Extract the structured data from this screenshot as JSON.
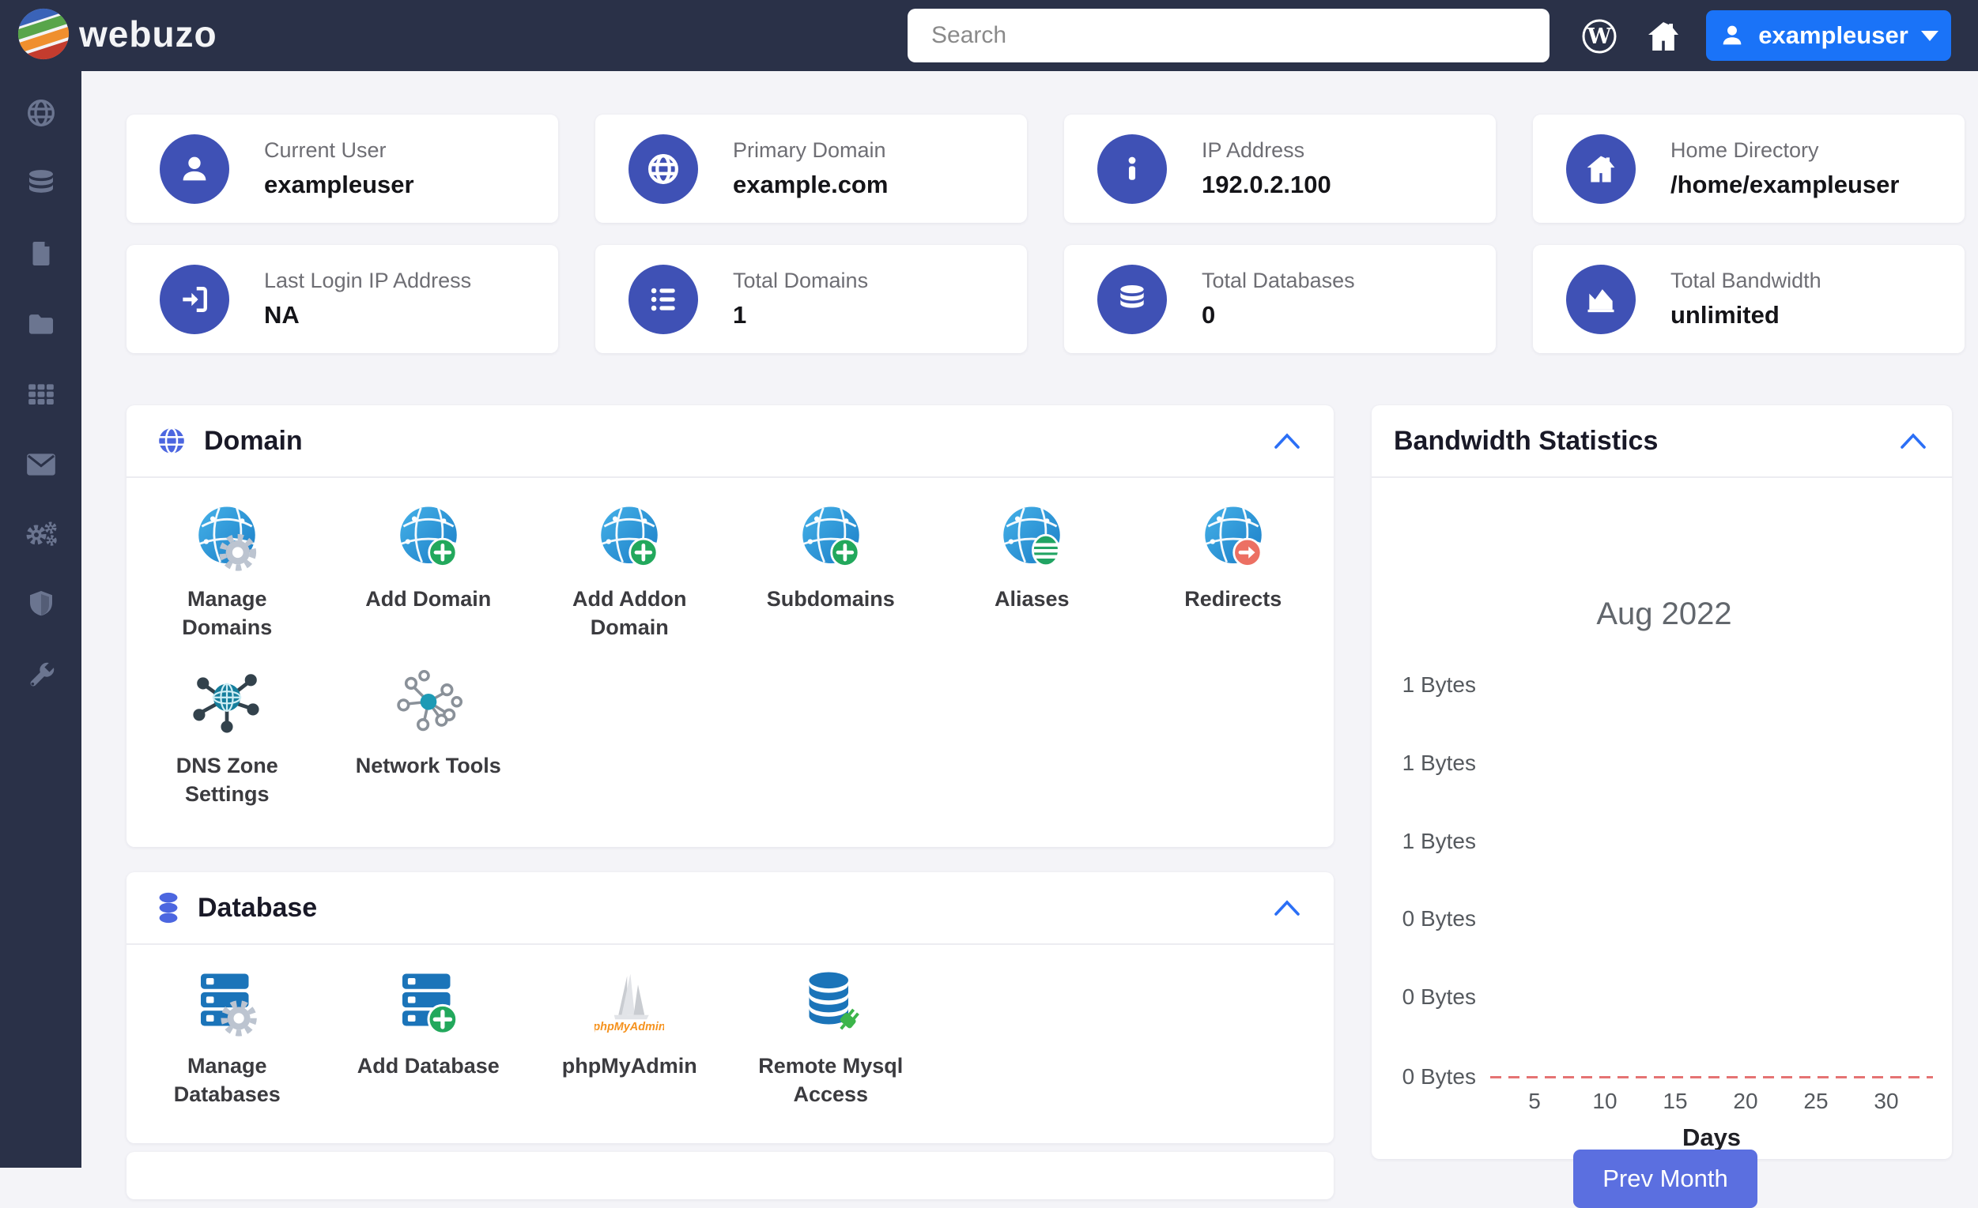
{
  "navbar": {
    "brand": "webuzo",
    "search_placeholder": "Search",
    "user_label": "exampleuser"
  },
  "sidebar": {
    "items": [
      {
        "icon": "globe-icon"
      },
      {
        "icon": "database-icon"
      },
      {
        "icon": "file-icon"
      },
      {
        "icon": "folder-icon"
      },
      {
        "icon": "apps-grid-icon"
      },
      {
        "icon": "mail-icon"
      },
      {
        "icon": "gears-icon"
      },
      {
        "icon": "shield-icon"
      },
      {
        "icon": "wrench-icon"
      }
    ]
  },
  "stats": [
    {
      "label": "Current User",
      "value": "exampleuser",
      "icon": "user-icon"
    },
    {
      "label": "Primary Domain",
      "value": "example.com",
      "icon": "globe-icon"
    },
    {
      "label": "IP Address",
      "value": "192.0.2.100",
      "icon": "info-icon"
    },
    {
      "label": "Home Directory",
      "value": "/home/exampleuser",
      "icon": "home-icon"
    },
    {
      "label": "Last Login IP Address",
      "value": "NA",
      "icon": "sign-in-icon"
    },
    {
      "label": "Total Domains",
      "value": "1",
      "icon": "list-icon"
    },
    {
      "label": "Total Databases",
      "value": "0",
      "icon": "database-icon"
    },
    {
      "label": "Total Bandwidth",
      "value": "unlimited",
      "icon": "area-chart-icon"
    }
  ],
  "domain_panel": {
    "title": "Domain",
    "items": [
      {
        "label": "Manage Domains",
        "icon": "globe-gear-icon"
      },
      {
        "label": "Add Domain",
        "icon": "globe-plus-icon"
      },
      {
        "label": "Add Addon Domain",
        "icon": "globe-plus-icon"
      },
      {
        "label": "Subdomains",
        "icon": "globe-plus-icon"
      },
      {
        "label": "Aliases",
        "icon": "globe-stack-icon"
      },
      {
        "label": "Redirects",
        "icon": "globe-arrow-icon"
      },
      {
        "label": "DNS Zone Settings",
        "icon": "dns-network-icon"
      },
      {
        "label": "Network Tools",
        "icon": "network-nodes-icon"
      }
    ]
  },
  "database_panel": {
    "title": "Database",
    "items": [
      {
        "label": "Manage Databases",
        "icon": "server-gear-icon"
      },
      {
        "label": "Add Database",
        "icon": "server-plus-icon"
      },
      {
        "label": "phpMyAdmin",
        "icon": "phpmyadmin-logo",
        "logo_text": "phpMyAdmin"
      },
      {
        "label": "Remote Mysql Access",
        "icon": "database-plug-icon"
      }
    ]
  },
  "bandwidth_panel": {
    "title": "Bandwidth Statistics",
    "prev_month_label": "Prev Month"
  },
  "chart_data": {
    "type": "line",
    "title": "Aug 2022",
    "xlabel": "Days",
    "x_ticks": [
      5,
      10,
      15,
      20,
      25,
      30
    ],
    "days_range": [
      1,
      31
    ],
    "y_tick_labels": [
      "1 Bytes",
      "1 Bytes",
      "1 Bytes",
      "0 Bytes",
      "0 Bytes",
      "0 Bytes"
    ],
    "series": [
      {
        "name": "Bandwidth",
        "values": [
          0,
          0,
          0,
          0,
          0,
          0,
          0,
          0,
          0,
          0,
          0,
          0,
          0,
          0,
          0,
          0,
          0,
          0,
          0,
          0,
          0,
          0,
          0,
          0,
          0,
          0,
          0,
          0,
          0,
          0,
          0
        ]
      }
    ],
    "ylim": [
      0,
      1
    ],
    "line_color": "#e57373",
    "line_style": "dashed",
    "grid": false,
    "legend": "none"
  },
  "colors": {
    "navbar_bg": "#2a3148",
    "user_button_blue": "#1a73f8",
    "stat_icon_circle": "#3f51b5",
    "panel_accent_blue": "#4c66e0",
    "chevron_blue": "#2b6ff6",
    "globe_blue": "#2a9fd8",
    "badge_green": "#22a85c",
    "badge_red": "#ec7063",
    "prev_month_indigo": "#5b6fe0",
    "dashed_line_red": "#e57373",
    "page_bg": "#f4f4f8"
  }
}
